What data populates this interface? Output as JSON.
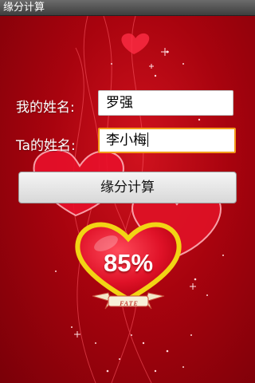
{
  "window": {
    "title": "缘分计算"
  },
  "form": {
    "my_name_label": "我的姓名:",
    "my_name_value": "罗强",
    "their_name_label": "Ta的姓名:",
    "their_name_value": "李小梅",
    "calculate_label": "缘分计算"
  },
  "result": {
    "percent_text": "85%",
    "ribbon_text": "FATE"
  },
  "colors": {
    "background": "#b0050f",
    "focus_border": "#f39c1a",
    "heart_outline": "#f2d414"
  }
}
